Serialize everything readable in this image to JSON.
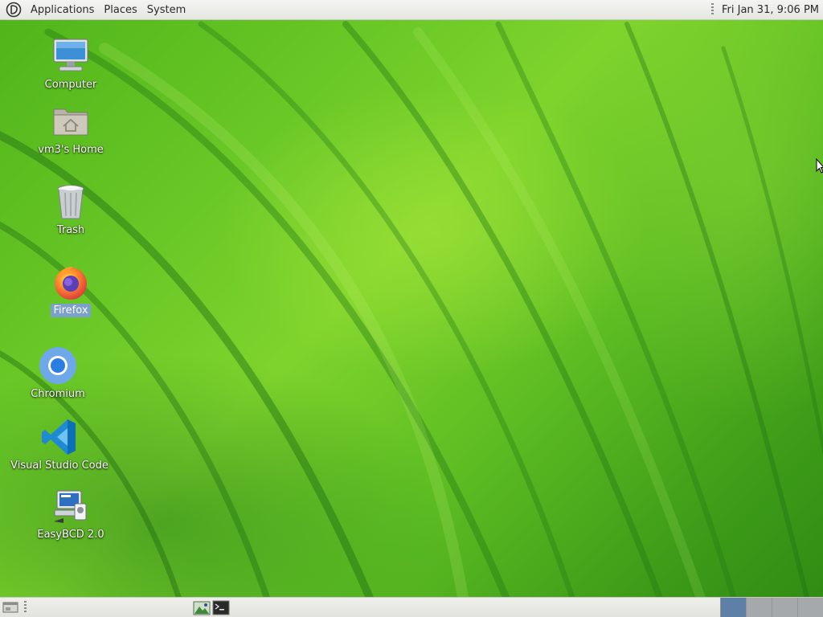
{
  "top_panel": {
    "menus": [
      "Applications",
      "Places",
      "System"
    ],
    "clock": "Fri Jan 31,  9:06 PM"
  },
  "desktop": {
    "icons": [
      {
        "label": "Computer",
        "icon": "computer-icon"
      },
      {
        "label": "vm3's Home",
        "icon": "home-folder-icon"
      },
      {
        "label": "Trash",
        "icon": "trash-icon"
      },
      {
        "label": "Firefox",
        "icon": "firefox-icon",
        "selected": true
      },
      {
        "label": "Chromium",
        "icon": "chromium-icon"
      },
      {
        "label": "Visual Studio Code",
        "icon": "vscode-icon"
      },
      {
        "label": "EasyBCD 2.0",
        "icon": "easybcd-icon"
      }
    ]
  },
  "bottom_panel": {
    "launchers": [
      "image-editor-icon",
      "terminal-icon"
    ],
    "workspaces": 4,
    "active_workspace": 1
  },
  "colors": {
    "selection": "#7ca0cc",
    "active_workspace": "#5e7fa6",
    "wallpaper_green": "#6cc927"
  }
}
